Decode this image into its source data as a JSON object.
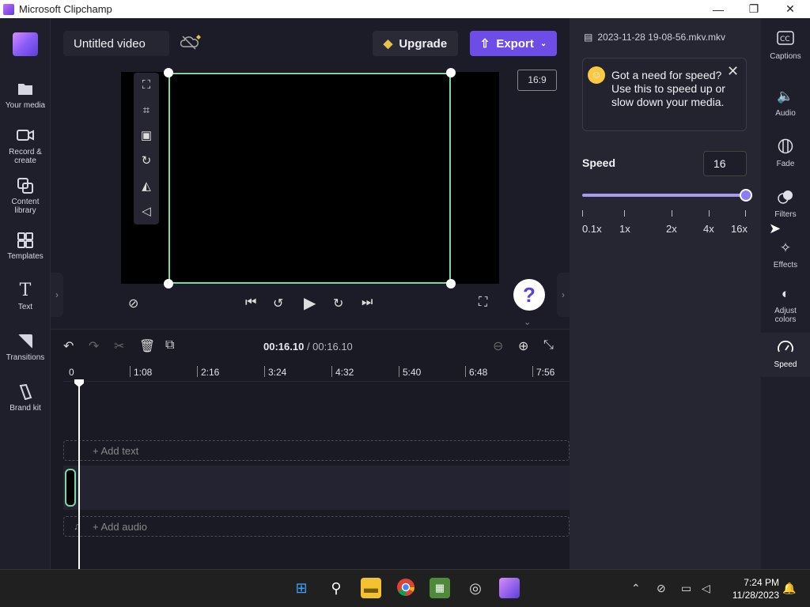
{
  "window": {
    "title": "Microsoft Clipchamp",
    "minimize_glyph": "—",
    "restore_glyph": "❐",
    "close_glyph": "✕"
  },
  "left_nav": {
    "items": [
      {
        "label1": "Your media",
        "label2": "",
        "icon": "folder-icon"
      },
      {
        "label1": "Record &",
        "label2": "create",
        "icon": "camera-icon"
      },
      {
        "label1": "Content",
        "label2": "library",
        "icon": "library-icon"
      },
      {
        "label1": "Templates",
        "label2": "",
        "icon": "templates-icon"
      },
      {
        "label1": "Text",
        "label2": "",
        "icon": "text-icon"
      },
      {
        "label1": "Transitions",
        "label2": "",
        "icon": "transitions-icon"
      },
      {
        "label1": "Brand kit",
        "label2": "",
        "icon": "brand-kit-icon"
      }
    ]
  },
  "topbar": {
    "project_title": "Untitled video",
    "upgrade_label": "Upgrade",
    "export_label": "Export"
  },
  "preview": {
    "aspect_ratio": "16:9"
  },
  "timeline": {
    "current_time": "00:16.10",
    "separator": " / ",
    "total_time": "00:16.10",
    "ruler_labels": [
      "0",
      "1:08",
      "2:16",
      "3:24",
      "4:32",
      "5:40",
      "6:48",
      "7:56"
    ],
    "add_text_label": "+ Add text",
    "add_audio_label": "+ Add audio"
  },
  "panel": {
    "filename": "2023-11-28 19-08-56.mkv.mkv",
    "tip_text": "Got a need for speed? Use this to speed up or slow down your media.",
    "speed_label": "Speed",
    "speed_value": "16",
    "speed_slider_fraction": 1.0,
    "speed_marks": [
      "0.1x",
      "1x",
      "2x",
      "4x",
      "16x"
    ]
  },
  "right_bar": {
    "items": [
      {
        "label1": "Captions",
        "label2": "",
        "icon": "captions-icon"
      },
      {
        "label1": "Audio",
        "label2": "",
        "icon": "audio-icon"
      },
      {
        "label1": "Fade",
        "label2": "",
        "icon": "fade-icon"
      },
      {
        "label1": "Filters",
        "label2": "",
        "icon": "filters-icon"
      },
      {
        "label1": "Effects",
        "label2": "",
        "icon": "effects-icon"
      },
      {
        "label1": "Adjust",
        "label2": "colors",
        "icon": "adjust-colors-icon"
      },
      {
        "label1": "Speed",
        "label2": "",
        "icon": "speed-icon"
      }
    ],
    "active": "Speed"
  },
  "taskbar": {
    "time": "7:24 PM",
    "date": "11/28/2023"
  },
  "colors": {
    "accent": "#6d4ce8",
    "selection": "#7ad8a8",
    "background": "#1c1c28"
  }
}
